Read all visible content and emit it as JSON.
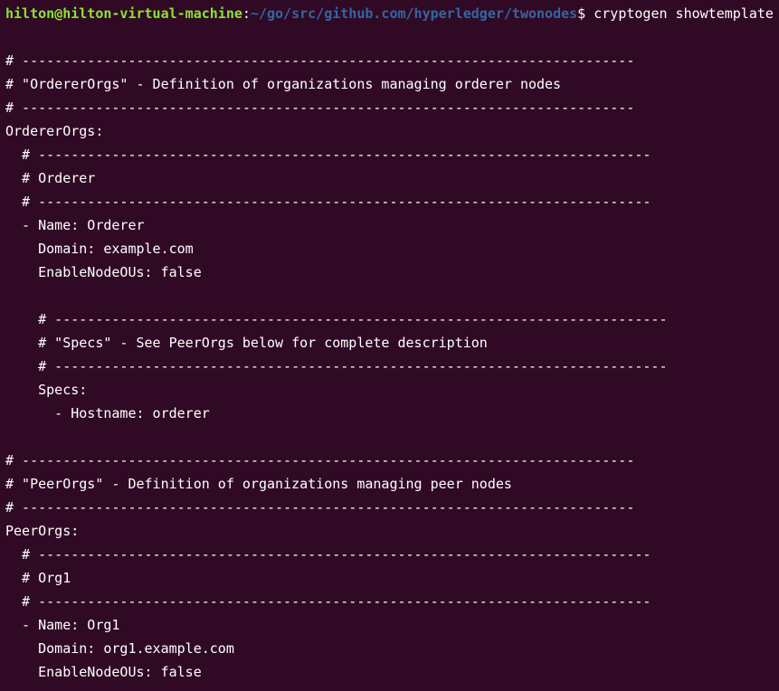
{
  "terminal": {
    "prompt": {
      "user_host": "hilton@hilton-virtual-machine",
      "colon": ":",
      "path": "~/go/src/github.com/hyperledger/twonodes",
      "dollar": "$ ",
      "command": "cryptogen showtemplate"
    },
    "lines": [
      "",
      "# ---------------------------------------------------------------------------",
      "# \"OrdererOrgs\" - Definition of organizations managing orderer nodes",
      "# ---------------------------------------------------------------------------",
      "OrdererOrgs:",
      "  # ---------------------------------------------------------------------------",
      "  # Orderer",
      "  # ---------------------------------------------------------------------------",
      "  - Name: Orderer",
      "    Domain: example.com",
      "    EnableNodeOUs: false",
      "",
      "    # ---------------------------------------------------------------------------",
      "    # \"Specs\" - See PeerOrgs below for complete description",
      "    # ---------------------------------------------------------------------------",
      "    Specs:",
      "      - Hostname: orderer",
      "",
      "# ---------------------------------------------------------------------------",
      "# \"PeerOrgs\" - Definition of organizations managing peer nodes",
      "# ---------------------------------------------------------------------------",
      "PeerOrgs:",
      "  # ---------------------------------------------------------------------------",
      "  # Org1",
      "  # ---------------------------------------------------------------------------",
      "  - Name: Org1",
      "    Domain: org1.example.com",
      "    EnableNodeOUs: false"
    ],
    "colors": {
      "background": "#300a24",
      "foreground": "#ffffff",
      "user_host": "#8ae234",
      "path": "#3465a4"
    }
  }
}
